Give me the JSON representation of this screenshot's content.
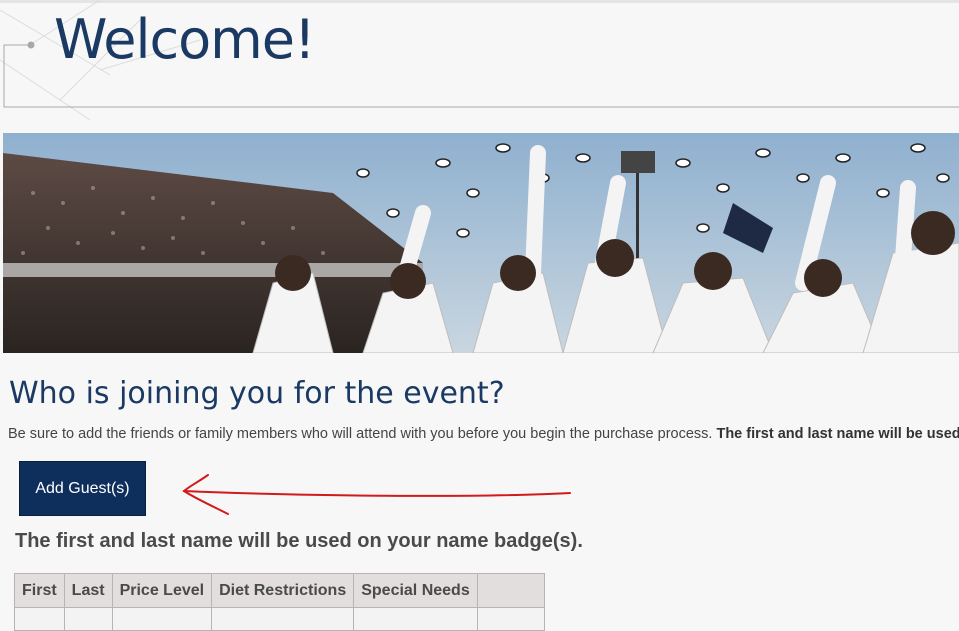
{
  "header": {
    "title": "Welcome!"
  },
  "main": {
    "section_heading": "Who is joining you for the event?",
    "intro_text": "Be sure to add the friends or family members who will attend with you before you begin the purchase process.",
    "intro_bold": "The first and last name will be used on your name badge(s).",
    "add_guest_label": "Add Guest(s)",
    "badge_note": "The first and last name will be used on your name badge(s).",
    "table": {
      "columns": [
        "First",
        "Last",
        "Price Level",
        "Diet Restrictions",
        "Special Needs",
        ""
      ]
    }
  },
  "colors": {
    "heading": "#1b3a63",
    "button_bg": "#0e2f5c",
    "annotation_arrow": "#d11a1a",
    "table_header_bg": "#e2dedd"
  },
  "icons": {
    "annotation": "red-hand-drawn-arrow"
  }
}
